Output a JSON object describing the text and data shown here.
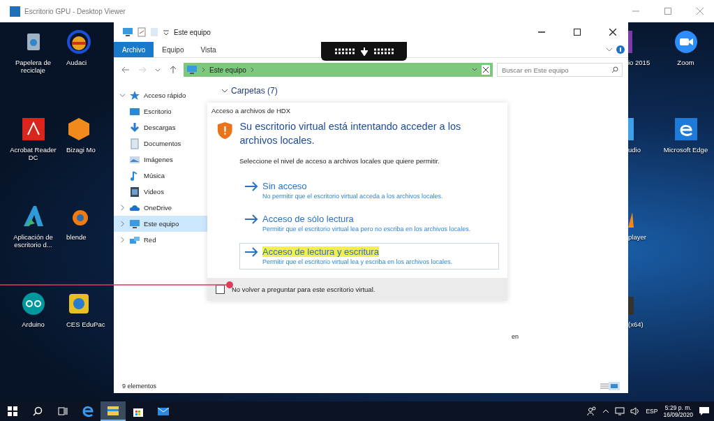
{
  "viewer": {
    "title": "Escritorio GPU - Desktop Viewer"
  },
  "desktop": {
    "left_columns": [
      {
        "icons": [
          {
            "label": "Papelera de reciclaje",
            "kind": "recycle"
          },
          {
            "label": "Acrobat Reader DC",
            "kind": "acrobat"
          },
          {
            "label": "Aplicación de escritorio d...",
            "kind": "azure"
          },
          {
            "label": "Arduino",
            "kind": "arduino"
          }
        ]
      },
      {
        "icons": [
          {
            "label": "Audaci",
            "kind": "audacity"
          },
          {
            "label": "Bizagi Mo",
            "kind": "bizagi"
          },
          {
            "label": "blende",
            "kind": "blender"
          },
          {
            "label": "CES EduPac",
            "kind": "ces"
          }
        ]
      }
    ],
    "right_columns": [
      {
        "icons": [
          {
            "label": "io 2015",
            "kind": "vs"
          },
          {
            "label": "udio",
            "kind": "vscode"
          },
          {
            "label": "player",
            "kind": "vlc"
          },
          {
            "label": "(x64)",
            "kind": "app"
          }
        ]
      },
      {
        "icons": [
          {
            "label": "Zoom",
            "kind": "zoom"
          },
          {
            "label": "Microsoft Edge",
            "kind": "edge"
          }
        ]
      }
    ]
  },
  "explorer": {
    "title": "Este equipo",
    "ribbon_tabs": [
      {
        "label": "Archivo",
        "selected": true
      },
      {
        "label": "Equipo",
        "selected": false
      },
      {
        "label": "Vista",
        "selected": false
      }
    ],
    "address": "Este equipo",
    "search": {
      "placeholder": "Buscar en Este equipo"
    },
    "nav": [
      {
        "label": "Acceso rápido",
        "kind": "star",
        "expanded": true,
        "selected": false,
        "children": [
          {
            "label": "Escritorio",
            "kind": "desktop",
            "selected": false
          },
          {
            "label": "Descargas",
            "kind": "download",
            "selected": false
          },
          {
            "label": "Documentos",
            "kind": "document",
            "selected": false
          },
          {
            "label": "Imágenes",
            "kind": "image",
            "selected": false
          },
          {
            "label": "Música",
            "kind": "music",
            "selected": false
          },
          {
            "label": "Videos",
            "kind": "video",
            "selected": false
          }
        ]
      },
      {
        "label": "OneDrive",
        "kind": "cloud",
        "expanded": false,
        "selected": false
      },
      {
        "label": "Este equipo",
        "kind": "pc",
        "expanded": false,
        "selected": true
      },
      {
        "label": "Red",
        "kind": "network",
        "expanded": false,
        "selected": false
      }
    ],
    "group_header": "Carpetas (7)",
    "background_text": "en",
    "status": "9 elementos"
  },
  "dialog": {
    "title": "Acceso a archivos de HDX",
    "heading": "Su escritorio virtual está intentando acceder a los archivos locales.",
    "prompt": "Seleccione el nivel de acceso a archivos locales que quiere permitir.",
    "options": [
      {
        "title": "Sin acceso",
        "description": "No permitir que el escritorio virtual acceda a los archivos locales.",
        "selected": false
      },
      {
        "title": "Acceso de sólo lectura",
        "description": "Permitir que el escritorio virtual lea pero no escriba en los archivos locales.",
        "selected": false
      },
      {
        "title": "Acceso de lectura y escritura",
        "description": "Permitir que el escritorio virtual lea y escriba en los archivos locales.",
        "selected": true
      }
    ],
    "dont_ask": {
      "label": "No volver a preguntar para este escritorio virtual.",
      "checked": false
    }
  },
  "taskbar": {
    "apps": [
      {
        "kind": "edge",
        "selected": false
      },
      {
        "kind": "explorer",
        "selected": true
      },
      {
        "kind": "store",
        "selected": false
      },
      {
        "kind": "mail",
        "selected": false
      }
    ],
    "language": "ESP",
    "time": "5:29 p. m.",
    "date": "16/09/2020"
  }
}
